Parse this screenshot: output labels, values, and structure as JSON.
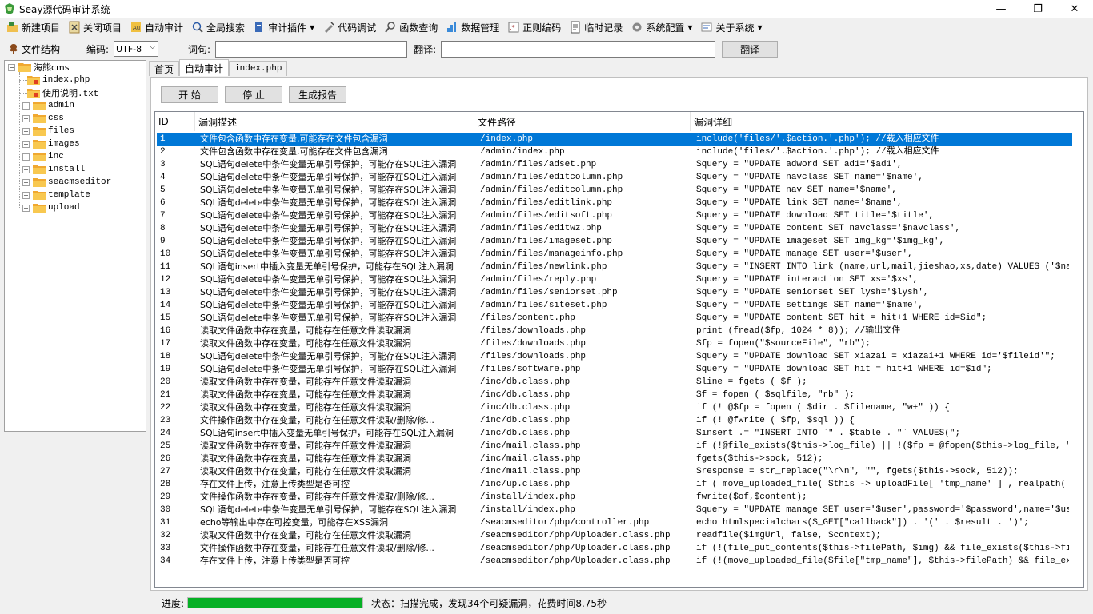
{
  "window": {
    "title": "Seay源代码审计系统",
    "controls": {
      "minimize": "—",
      "maximize": "❐",
      "close": "✕"
    }
  },
  "toolbar": {
    "items": [
      {
        "label": "新建项目",
        "icon": "new-project-icon"
      },
      {
        "label": "关闭项目",
        "icon": "close-project-icon"
      },
      {
        "label": "自动审计",
        "icon": "auto-audit-icon"
      },
      {
        "label": "全局搜索",
        "icon": "global-search-icon"
      },
      {
        "label": "审计插件",
        "icon": "plugin-icon",
        "dropdown": true
      },
      {
        "label": "代码调试",
        "icon": "debug-icon"
      },
      {
        "label": "函数查询",
        "icon": "function-query-icon"
      },
      {
        "label": "数据管理",
        "icon": "data-manage-icon"
      },
      {
        "label": "正则编码",
        "icon": "regex-icon"
      },
      {
        "label": "临时记录",
        "icon": "notes-icon"
      },
      {
        "label": "系统配置",
        "icon": "gear-icon",
        "dropdown": true
      },
      {
        "label": "关于系统",
        "icon": "about-icon",
        "dropdown": true
      }
    ]
  },
  "options": {
    "file_structure_label": "文件结构",
    "encoding_label": "编码:",
    "encoding_value": "UTF-8",
    "word_label": "词句:",
    "word_value": "",
    "translate_label": "翻译:",
    "translate_value": "",
    "translate_button": "翻译"
  },
  "tree": {
    "root": "海熊cms",
    "files": [
      "index.php",
      "使用说明.txt"
    ],
    "folders": [
      "admin",
      "css",
      "files",
      "images",
      "inc",
      "install",
      "seacmseditor",
      "template",
      "upload"
    ]
  },
  "tabs": [
    "首页",
    "自动审计",
    "index.php"
  ],
  "actions": {
    "start": "开 始",
    "stop": "停 止",
    "report": "生成报告"
  },
  "results": {
    "columns": {
      "id": "ID",
      "desc": "漏洞描述",
      "path": "文件路径",
      "detail": "漏洞详细"
    },
    "rows": [
      {
        "id": "1",
        "desc": "文件包含函数中存在变量,可能存在文件包含漏洞",
        "path": "/index.php",
        "detail": "include('files/'.$action.'.php'); //载入相应文件"
      },
      {
        "id": "2",
        "desc": "文件包含函数中存在变量,可能存在文件包含漏洞",
        "path": "/admin/index.php",
        "detail": "include('files/'.$action.'.php'); //载入相应文件"
      },
      {
        "id": "3",
        "desc": "SQL语句delete中条件变量无单引号保护，可能存在SQL注入漏洞",
        "path": "/admin/files/adset.php",
        "detail": "$query = \"UPDATE adword SET ad1='$ad1',"
      },
      {
        "id": "4",
        "desc": "SQL语句delete中条件变量无单引号保护，可能存在SQL注入漏洞",
        "path": "/admin/files/editcolumn.php",
        "detail": "$query = \"UPDATE navclass SET name='$name',"
      },
      {
        "id": "5",
        "desc": "SQL语句delete中条件变量无单引号保护，可能存在SQL注入漏洞",
        "path": "/admin/files/editcolumn.php",
        "detail": "$query = \"UPDATE nav SET name='$name',"
      },
      {
        "id": "6",
        "desc": "SQL语句delete中条件变量无单引号保护，可能存在SQL注入漏洞",
        "path": "/admin/files/editlink.php",
        "detail": "$query = \"UPDATE link SET name='$name',"
      },
      {
        "id": "7",
        "desc": "SQL语句delete中条件变量无单引号保护，可能存在SQL注入漏洞",
        "path": "/admin/files/editsoft.php",
        "detail": "$query = \"UPDATE download SET title='$title',"
      },
      {
        "id": "8",
        "desc": "SQL语句delete中条件变量无单引号保护，可能存在SQL注入漏洞",
        "path": "/admin/files/editwz.php",
        "detail": "$query = \"UPDATE content SET navclass='$navclass',"
      },
      {
        "id": "9",
        "desc": "SQL语句delete中条件变量无单引号保护，可能存在SQL注入漏洞",
        "path": "/admin/files/imageset.php",
        "detail": "$query = \"UPDATE imageset SET img_kg='$img_kg',"
      },
      {
        "id": "10",
        "desc": "SQL语句delete中条件变量无单引号保护，可能存在SQL注入漏洞",
        "path": "/admin/files/manageinfo.php",
        "detail": "$query = \"UPDATE manage SET user='$user',"
      },
      {
        "id": "11",
        "desc": "SQL语句insert中插入变量无单引号保护，可能存在SQL注入漏洞",
        "path": "/admin/files/newlink.php",
        "detail": "$query = \"INSERT INTO link (name,url,mail,jieshao,xs,date) VALUES ('$name'..."
      },
      {
        "id": "12",
        "desc": "SQL语句delete中条件变量无单引号保护，可能存在SQL注入漏洞",
        "path": "/admin/files/reply.php",
        "detail": "$query = \"UPDATE interaction SET xs='$xs',"
      },
      {
        "id": "13",
        "desc": "SQL语句delete中条件变量无单引号保护，可能存在SQL注入漏洞",
        "path": "/admin/files/seniorset.php",
        "detail": "$query = \"UPDATE seniorset SET lysh='$lysh',"
      },
      {
        "id": "14",
        "desc": "SQL语句delete中条件变量无单引号保护，可能存在SQL注入漏洞",
        "path": "/admin/files/siteset.php",
        "detail": "$query = \"UPDATE settings SET name='$name',"
      },
      {
        "id": "15",
        "desc": "SQL语句delete中条件变量无单引号保护，可能存在SQL注入漏洞",
        "path": "/files/content.php",
        "detail": "$query = \"UPDATE content SET hit = hit+1 WHERE id=$id\";"
      },
      {
        "id": "16",
        "desc": "读取文件函数中存在变量，可能存在任意文件读取漏洞",
        "path": "/files/downloads.php",
        "detail": "print (fread($fp, 1024 * 8)); //输出文件"
      },
      {
        "id": "17",
        "desc": "读取文件函数中存在变量，可能存在任意文件读取漏洞",
        "path": "/files/downloads.php",
        "detail": "$fp = fopen(\"$sourceFile\", \"rb\");"
      },
      {
        "id": "18",
        "desc": "SQL语句delete中条件变量无单引号保护，可能存在SQL注入漏洞",
        "path": "/files/downloads.php",
        "detail": "$query = \"UPDATE download SET xiazai = xiazai+1 WHERE id='$fileid'\";"
      },
      {
        "id": "19",
        "desc": "SQL语句delete中条件变量无单引号保护，可能存在SQL注入漏洞",
        "path": "/files/software.php",
        "detail": "$query = \"UPDATE download SET hit = hit+1 WHERE id=$id\";"
      },
      {
        "id": "20",
        "desc": "读取文件函数中存在变量，可能存在任意文件读取漏洞",
        "path": "/inc/db.class.php",
        "detail": "$line = fgets ( $f );"
      },
      {
        "id": "21",
        "desc": "读取文件函数中存在变量，可能存在任意文件读取漏洞",
        "path": "/inc/db.class.php",
        "detail": "$f = fopen ( $sqlfile, \"rb\" );"
      },
      {
        "id": "22",
        "desc": "读取文件函数中存在变量，可能存在任意文件读取漏洞",
        "path": "/inc/db.class.php",
        "detail": "if (! @$fp = fopen ( $dir . $filename, \"w+\" )) {"
      },
      {
        "id": "23",
        "desc": "文件操作函数中存在变量，可能存在任意文件读取/删除/修...",
        "path": "/inc/db.class.php",
        "detail": "if (! @fwrite ( $fp, $sql )) {"
      },
      {
        "id": "24",
        "desc": "SQL语句insert中插入变量无单引号保护，可能存在SQL注入漏洞",
        "path": "/inc/db.class.php",
        "detail": "$insert .= \"INSERT INTO `\" . $table . \"` VALUES(\";"
      },
      {
        "id": "25",
        "desc": "读取文件函数中存在变量，可能存在任意文件读取漏洞",
        "path": "/inc/mail.class.php",
        "detail": "if (!@file_exists($this->log_file) || !($fp = @fopen($this->log_file, \"a\")..."
      },
      {
        "id": "26",
        "desc": "读取文件函数中存在变量，可能存在任意文件读取漏洞",
        "path": "/inc/mail.class.php",
        "detail": "fgets($this->sock, 512);"
      },
      {
        "id": "27",
        "desc": "读取文件函数中存在变量，可能存在任意文件读取漏洞",
        "path": "/inc/mail.class.php",
        "detail": "$response = str_replace(\"\\r\\n\", \"\", fgets($this->sock, 512));"
      },
      {
        "id": "28",
        "desc": "存在文件上传，注意上传类型是否可控",
        "path": "/inc/up.class.php",
        "detail": "if ( move_uploaded_file( $this -> uploadFile[ 'tmp_name' ] , realpath( $th..."
      },
      {
        "id": "29",
        "desc": "文件操作函数中存在变量，可能存在任意文件读取/删除/修...",
        "path": "/install/index.php",
        "detail": "fwrite($of,$content);"
      },
      {
        "id": "30",
        "desc": "SQL语句delete中条件变量无单引号保护，可能存在SQL注入漏洞",
        "path": "/install/index.php",
        "detail": "$query = \"UPDATE manage SET user='$user',password='$password',name='$user'\";"
      },
      {
        "id": "31",
        "desc": "echo等输出中存在可控变量，可能存在XSS漏洞",
        "path": "/seacmseditor/php/controller.php",
        "detail": "echo htmlspecialchars($_GET[\"callback\"]) . '(' . $result . ')';"
      },
      {
        "id": "32",
        "desc": "读取文件函数中存在变量，可能存在任意文件读取漏洞",
        "path": "/seacmseditor/php/Uploader.class.php",
        "detail": "readfile($imgUrl, false, $context);"
      },
      {
        "id": "33",
        "desc": "文件操作函数中存在变量，可能存在任意文件读取/删除/修...",
        "path": "/seacmseditor/php/Uploader.class.php",
        "detail": "if (!(file_put_contents($this->filePath, $img) && file_exists($this->fileP..."
      },
      {
        "id": "34",
        "desc": "存在文件上传，注意上传类型是否可控",
        "path": "/seacmseditor/php/Uploader.class.php",
        "detail": "if (!(move_uploaded_file($file[\"tmp_name\"], $this->filePath) && file_exist..."
      }
    ],
    "selected_row": 0
  },
  "status": {
    "progress_label": "进度:",
    "progress_value": 1.0,
    "progress_color": "#06b025",
    "text": "状态：扫描完成，发现34个可疑漏洞，花费时间8.75秒"
  },
  "colors": {
    "selection": "#0078d7",
    "folder": "#f0a830"
  }
}
